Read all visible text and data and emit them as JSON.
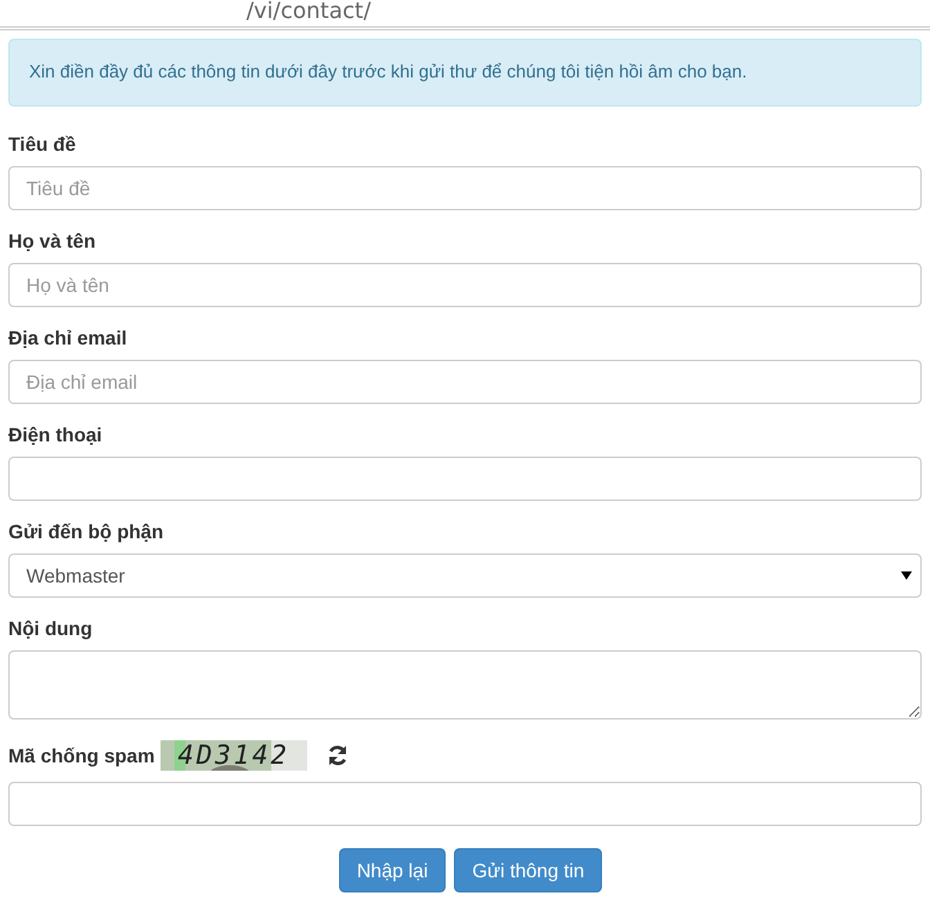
{
  "address_bar": {
    "url": "/vi/contact/"
  },
  "alert": {
    "text": "Xin điền đầy đủ các thông tin dưới đây trước khi gửi thư để chúng tôi tiện hồi âm cho bạn."
  },
  "fields": [
    {
      "kind": "text",
      "label": "Tiêu đề",
      "placeholder": "Tiêu đề"
    },
    {
      "kind": "text",
      "label": "Họ và tên",
      "placeholder": "Họ và tên"
    },
    {
      "kind": "text",
      "label": "Địa chỉ email",
      "placeholder": "Địa chỉ email"
    },
    {
      "kind": "text",
      "label": "Điện thoại"
    },
    {
      "kind": "select",
      "label": "Gửi đến bộ phận",
      "value": "Webmaster"
    },
    {
      "kind": "textarea",
      "label": "Nội dung"
    }
  ],
  "captcha": {
    "label": "Mã chống spam",
    "code": "4D3142"
  },
  "buttons": [
    "Nhập lại",
    "Gửi thông tin"
  ]
}
